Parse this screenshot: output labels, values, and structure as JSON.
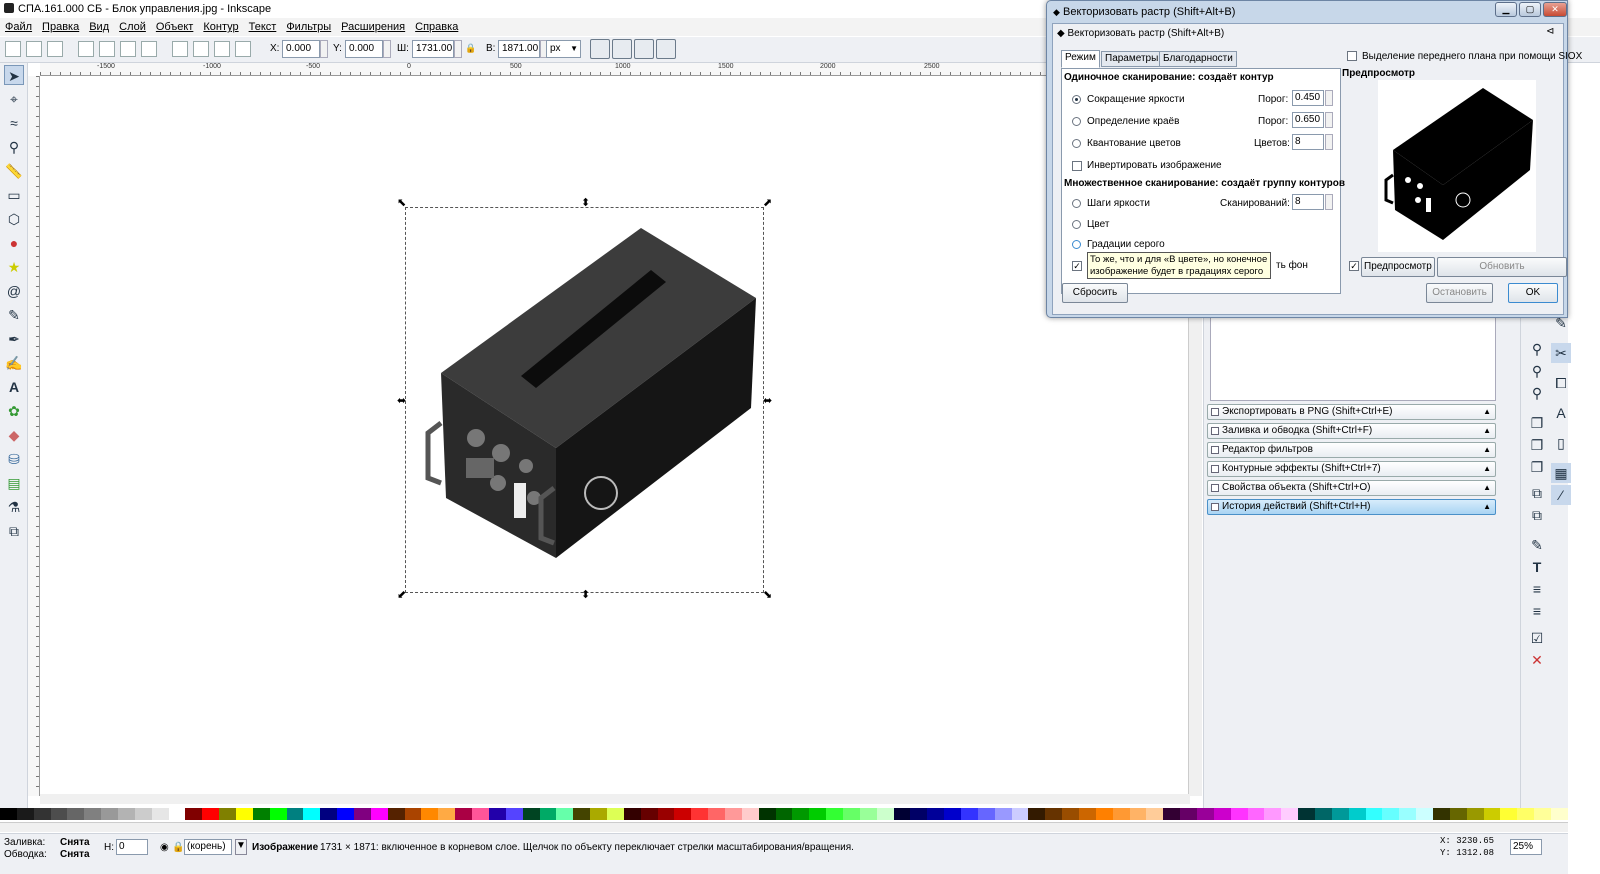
{
  "window": {
    "title": "СПА.161.000 СБ - Блок управления.jpg - Inkscape"
  },
  "menu": [
    "Файл",
    "Правка",
    "Вид",
    "Слой",
    "Объект",
    "Контур",
    "Текст",
    "Фильтры",
    "Расширения",
    "Справка"
  ],
  "toolbar": {
    "x_label": "X:",
    "x": "0.000",
    "y_label": "Y:",
    "y": "0.000",
    "w_label": "Ш:",
    "w": "1731.00",
    "h_label": "В:",
    "h": "1871.00",
    "unit": "px"
  },
  "ruler_labels": [
    "-1500",
    "-1000",
    "-500",
    "0",
    "500",
    "1000",
    "1500",
    "2000",
    "2500"
  ],
  "dialog": {
    "title": "Векторизовать растр (Shift+Alt+B)",
    "inner_title": "Векторизовать растр (Shift+Alt+B)",
    "tabs": [
      "Режим",
      "Параметры",
      "Благодарности"
    ],
    "single_header": "Одиночное сканирование: создаёт контур",
    "brightness": {
      "label": "Сокращение яркости",
      "param": "Порог:",
      "value": "0.450"
    },
    "edges": {
      "label": "Определение краёв",
      "param": "Порог:",
      "value": "0.650"
    },
    "quant": {
      "label": "Квантование цветов",
      "param": "Цветов:",
      "value": "8"
    },
    "invert": "Инвертировать изображение",
    "multi_header": "Множественное сканирование: создаёт группу контуров",
    "steps": {
      "label": "Шаги яркости",
      "param": "Сканирований:",
      "value": "8"
    },
    "color": "Цвет",
    "gray": "Градации серого",
    "bg_suffix": "ть фон",
    "siox": "Выделение переднего плана при помощи SIOX",
    "preview_label": "Предпросмотр",
    "preview_check": "Предпросмотр",
    "update": "Обновить",
    "reset": "Сбросить",
    "stop": "Остановить",
    "ok": "OK"
  },
  "tooltip": {
    "line1": "То же, что и для «В цвете», но конечное",
    "line2": "изображение будет в градациях серого"
  },
  "docks": [
    "Экспортировать в PNG (Shift+Ctrl+E)",
    "Заливка и обводка (Shift+Ctrl+F)",
    "Редактор фильтров",
    "Контурные эффекты (Shift+Ctrl+7)",
    "Свойства объекта (Shift+Ctrl+O)",
    "История действий (Shift+Ctrl+H)"
  ],
  "status": {
    "fill_label": "Заливка:",
    "fill_value": "Снята",
    "stroke_label": "Обводка:",
    "stroke_value": "Снята",
    "h_label": "Н:",
    "h_value": "0",
    "layer": "(корень)",
    "object": "Изображение",
    "message": "1731 × 1871: включенное в корневом слое. Щелчок по объекту переключает стрелки масштабирования/вращения.",
    "x_coord": "X: 3230.65",
    "y_coord": "Y: 1312.08",
    "zoom": "25%"
  },
  "palette": [
    "#000",
    "#1a1a1a",
    "#333",
    "#4d4d4d",
    "#666",
    "#808080",
    "#999",
    "#b3b3b3",
    "#ccc",
    "#e6e6e6",
    "#fff",
    "#800000",
    "#f00",
    "#808000",
    "#ff0",
    "#008000",
    "#0f0",
    "#008080",
    "#0ff",
    "#000080",
    "#00f",
    "#800080",
    "#f0f",
    "#552200",
    "#aa4400",
    "#ff8800",
    "#ffaa44",
    "#aa0044",
    "#ff5599",
    "#2200aa",
    "#5544ff",
    "#004422",
    "#00aa66",
    "#66ffaa",
    "#444400",
    "#aaaa00",
    "#ddff55",
    "#330000",
    "#660000",
    "#990000",
    "#cc0000",
    "#ff3333",
    "#ff6666",
    "#ff9999",
    "#ffcccc",
    "#003300",
    "#006600",
    "#009900",
    "#00cc00",
    "#33ff33",
    "#66ff66",
    "#99ff99",
    "#ccffcc",
    "#000033",
    "#000066",
    "#000099",
    "#0000cc",
    "#3333ff",
    "#6666ff",
    "#9999ff",
    "#ccccff",
    "#331a00",
    "#663300",
    "#994d00",
    "#cc6600",
    "#ff8000",
    "#ff9933",
    "#ffb366",
    "#ffcc99",
    "#330033",
    "#660066",
    "#990099",
    "#cc00cc",
    "#ff33ff",
    "#ff66ff",
    "#ff99ff",
    "#ffccff",
    "#003333",
    "#006666",
    "#009999",
    "#00cccc",
    "#33ffff",
    "#66ffff",
    "#99ffff",
    "#ccffff",
    "#333300",
    "#666600",
    "#999900",
    "#cccc00",
    "#ffff33",
    "#ffff66",
    "#ffff99",
    "#ffffcc"
  ]
}
